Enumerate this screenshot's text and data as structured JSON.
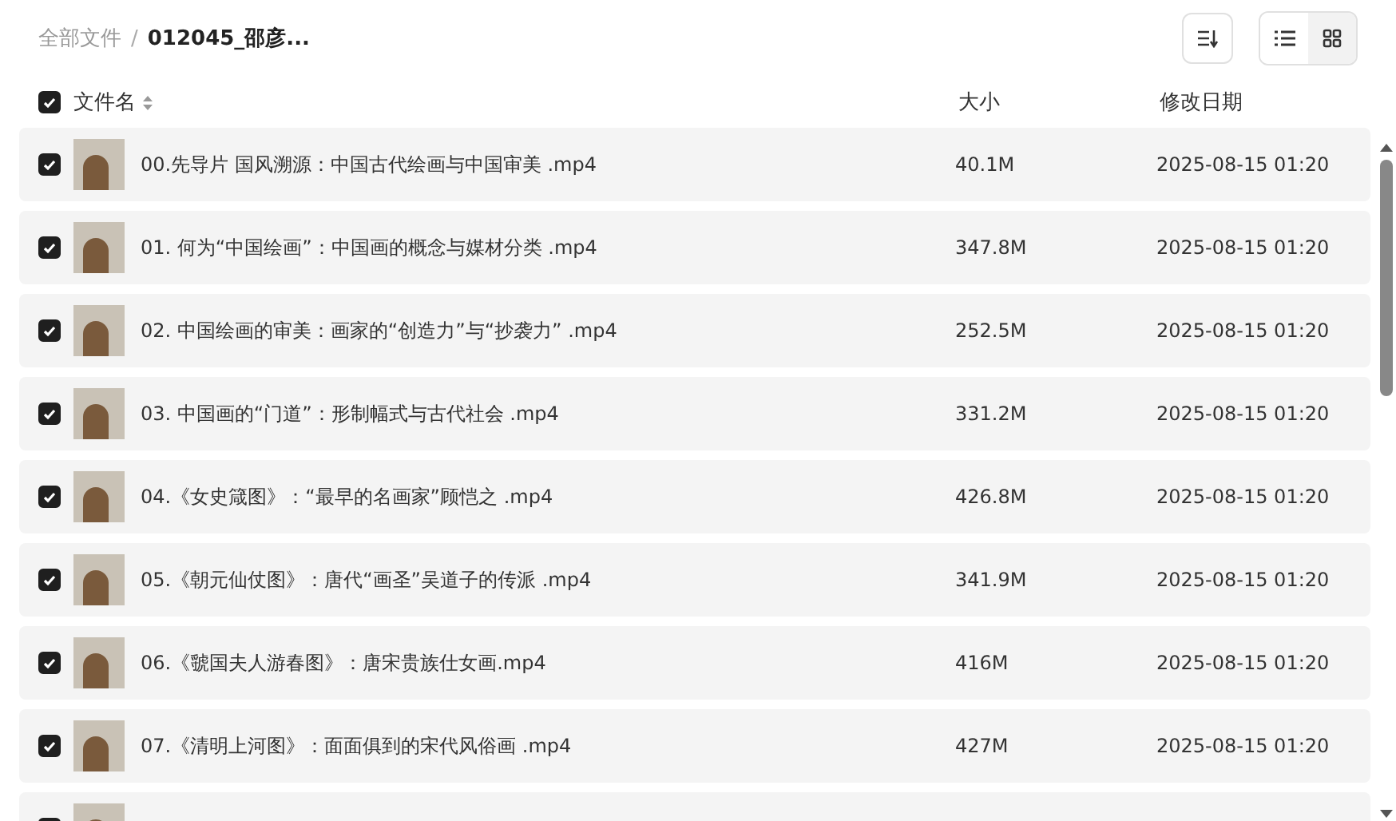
{
  "breadcrumb": {
    "separator": "/",
    "items": [
      {
        "label": "全部文件",
        "current": false
      },
      {
        "label": "012045_邵彦...",
        "current": true
      }
    ]
  },
  "view_toggle": [
    {
      "kind": "list",
      "selected": true
    },
    {
      "kind": "grid",
      "selected": false
    }
  ],
  "table": {
    "select_all": {
      "checked": true
    },
    "columns": [
      {
        "label": "文件名",
        "sortable": true
      },
      {
        "label": "大小",
        "sortable": false
      },
      {
        "label": "修改日期",
        "sortable": false
      }
    ],
    "rows": [
      {
        "name": "00.先导片 国风溯源：中国古代绘画与中国审美 .mp4",
        "size": "40.1M",
        "modified": "2025-08-15 01:20",
        "checked": true
      },
      {
        "name": "01. 何为“中国绘画”：中国画的概念与媒材分类 .mp4",
        "size": "347.8M",
        "modified": "2025-08-15 01:20",
        "checked": true
      },
      {
        "name": "02. 中国绘画的审美：画家的“创造力”与“抄袭力” .mp4",
        "size": "252.5M",
        "modified": "2025-08-15 01:20",
        "checked": true
      },
      {
        "name": "03. 中国画的“门道”：形制幅式与古代社会 .mp4",
        "size": "331.2M",
        "modified": "2025-08-15 01:20",
        "checked": true
      },
      {
        "name": "04.《女史箴图》：“最早的名画家”顾恺之 .mp4",
        "size": "426.8M",
        "modified": "2025-08-15 01:20",
        "checked": true
      },
      {
        "name": "05.《朝元仙仗图》：唐代“画圣”吴道子的传派 .mp4",
        "size": "341.9M",
        "modified": "2025-08-15 01:20",
        "checked": true
      },
      {
        "name": "06.《虢国夫人游春图》：唐宋贵族仕女画.mp4",
        "size": "416M",
        "modified": "2025-08-15 01:20",
        "checked": true
      },
      {
        "name": "07.《清明上河图》：面面俱到的宋代风俗画 .mp4",
        "size": "427M",
        "modified": "2025-08-15 01:20",
        "checked": true
      }
    ],
    "partial_row": {
      "checked": true
    }
  }
}
